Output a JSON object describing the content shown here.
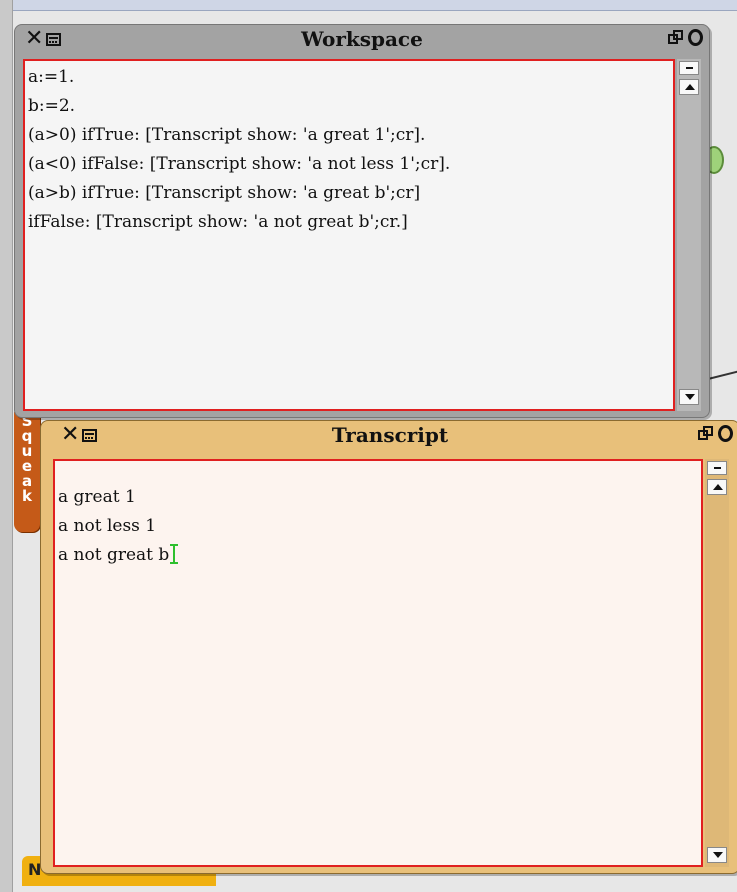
{
  "desktop": {
    "flap_label": "Squeak",
    "bottom_tab_label": "N"
  },
  "workspace": {
    "title": "Workspace",
    "lines": [
      "a:=1.",
      "b:=2.",
      "(a>0) ifTrue: [Transcript show: 'a great 1';cr].",
      "(a<0) ifFalse: [Transcript show: 'a not less 1';cr].",
      "(a>b) ifTrue: [Transcript show: 'a great b';cr]",
      "ifFalse: [Transcript show: 'a not great b';cr.]"
    ]
  },
  "transcript": {
    "title": "Transcript",
    "lines": [
      "a great 1",
      "a not less 1",
      "a not great b"
    ]
  },
  "colors": {
    "workspace_frame": "#a3a3a3",
    "transcript_frame": "#e8c07a",
    "pane_border": "#e02020",
    "cursor": "#2ec02e",
    "flap": "#c55a18"
  }
}
